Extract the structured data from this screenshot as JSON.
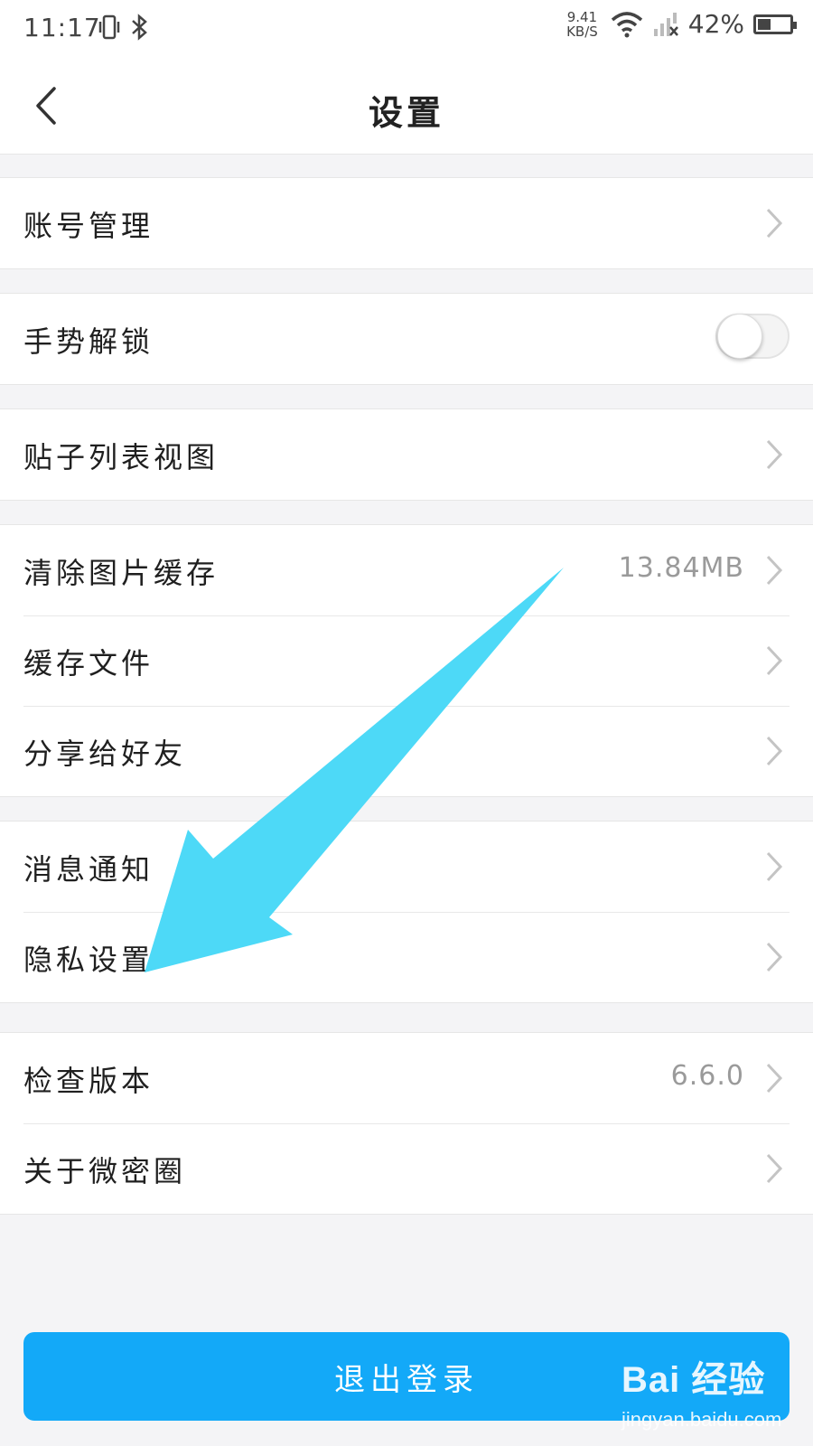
{
  "status_bar": {
    "time": "11:17",
    "net_speed_value": "9.41",
    "net_speed_unit": "KB/S",
    "battery_percent": "42%",
    "battery_level": 0.42,
    "icons": [
      "vibrate-icon",
      "bluetooth-icon",
      "wifi-icon",
      "signal-off-icon",
      "battery-icon"
    ]
  },
  "header": {
    "title": "设置",
    "back_icon": "back-chevron-icon"
  },
  "settings": {
    "account": {
      "label": "账号管理"
    },
    "gesture_unlock": {
      "label": "手势解锁",
      "toggle_on": false
    },
    "post_list_view": {
      "label": "贴子列表视图"
    },
    "clear_image_cache": {
      "label": "清除图片缓存",
      "value": "13.84MB"
    },
    "cache_files": {
      "label": "缓存文件"
    },
    "share_to_friends": {
      "label": "分享给好友"
    },
    "notifications": {
      "label": "消息通知"
    },
    "privacy_settings": {
      "label": "隐私设置"
    },
    "check_version": {
      "label": "检查版本",
      "value": "6.6.0"
    },
    "about": {
      "label": "关于微密圈"
    }
  },
  "logout": {
    "label": "退出登录"
  },
  "watermark": {
    "logo": "Bai 经验",
    "url": "jingyan.baidu.com"
  },
  "colors": {
    "accent_blue": "#13a9f8",
    "annotation_arrow": "#4dd9f7",
    "background": "#f4f4f6"
  }
}
